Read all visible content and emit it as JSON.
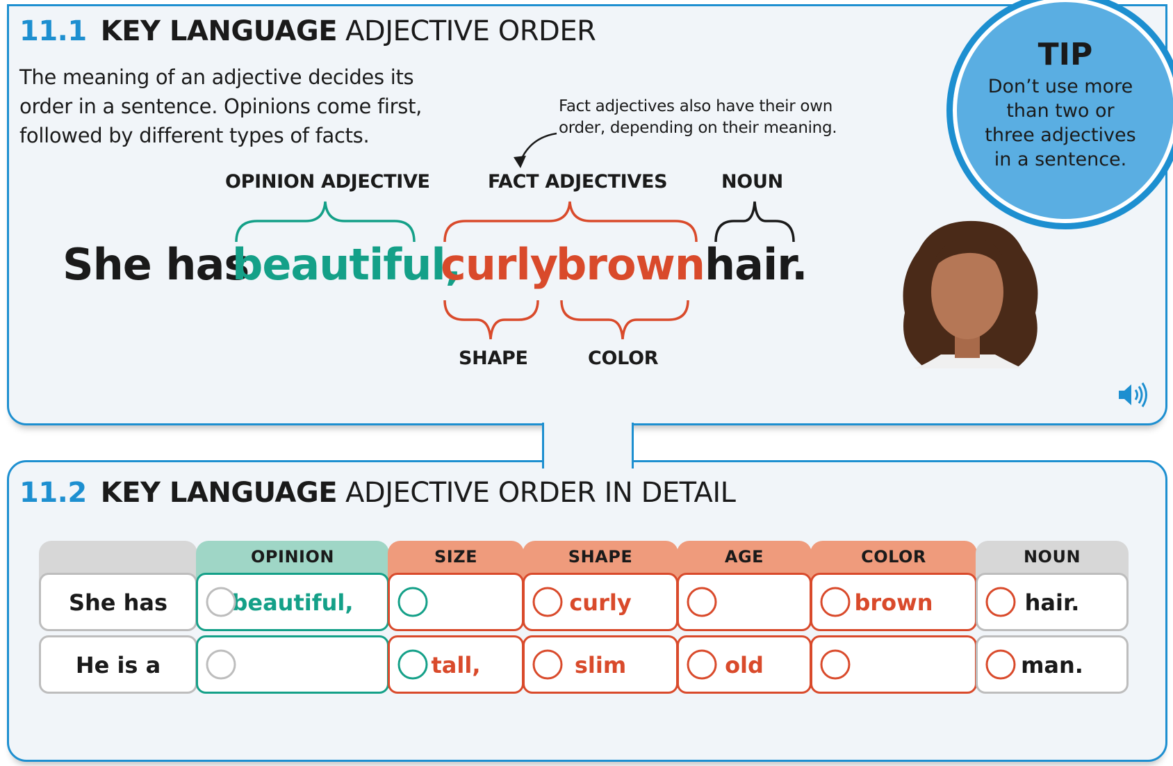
{
  "section1": {
    "number": "11.1",
    "key": "KEY LANGUAGE",
    "title": "ADJECTIVE ORDER",
    "intro": "The meaning of an adjective decides its order in a sentence. Opinions come first, followed by different types of facts.",
    "note": "Fact adjectives also have their own order, depending on their meaning.",
    "labels": {
      "opinion": "OPINION ADJECTIVE",
      "fact": "FACT ADJECTIVES",
      "noun": "NOUN",
      "shape": "SHAPE",
      "color": "COLOR"
    },
    "sentence": {
      "start": "She has",
      "opinion": "beautiful,",
      "shape": "curly",
      "color": "brown",
      "noun": "hair."
    }
  },
  "tip": {
    "title": "TIP",
    "body": "Don’t use more than two or three adjectives in a sentence."
  },
  "section2": {
    "number": "11.2",
    "key": "KEY LANGUAGE",
    "title": "ADJECTIVE ORDER IN DETAIL",
    "headers": [
      "",
      "OPINION",
      "SIZE",
      "SHAPE",
      "AGE",
      "COLOR",
      "NOUN"
    ],
    "rows": [
      [
        "She has",
        "beautiful,",
        "",
        "curly",
        "",
        "brown",
        "hair."
      ],
      [
        "He is a",
        "",
        "tall,",
        "slim",
        "old",
        "",
        "man."
      ]
    ]
  },
  "colors": {
    "accent_blue": "#1d8fd0",
    "opinion_teal": "#14a088",
    "fact_red": "#d94a2b",
    "noun_gray": "#cfcfcf"
  },
  "icons": [
    "speaker-icon",
    "woman-portrait-illustration"
  ]
}
